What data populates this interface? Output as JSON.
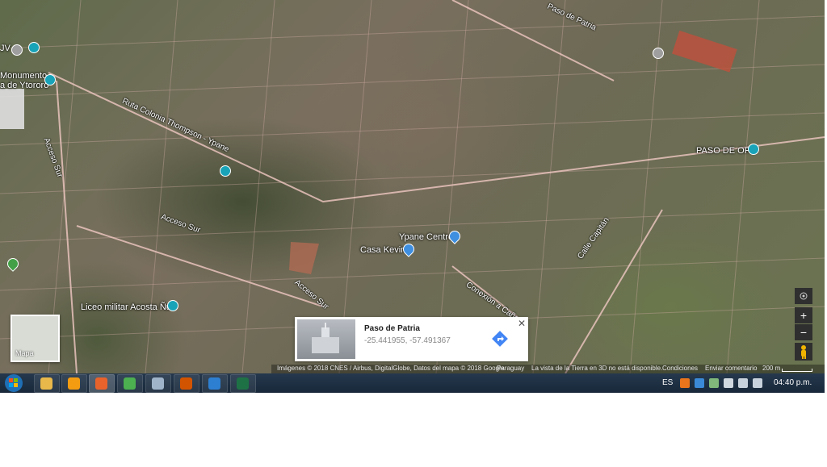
{
  "map": {
    "road_labels": {
      "paso_de_patria": "Paso de Patria",
      "ruta_colonia": "Ruta Colonia Thompson - Ypane",
      "acceso_sur_1": "Acceso Sur",
      "acceso_sur_2": "Acceso Sur",
      "acceso_sur_3": "Acceso Sur",
      "calle_capitan": "Calle Capitán",
      "conexion": "Conexión a Cañada"
    },
    "places": {
      "monumento": "Monumento",
      "ytororo": "a de Ytororo",
      "jv": "JV",
      "paso_de_oro": "PASO DE ORO",
      "ypane_centro": "Ypane Centro",
      "casa_kevin": "Casa Kevin",
      "liceo": "Liceo militar Acosta Ñu"
    },
    "thumbnail_label": "Mapa",
    "controls": {
      "zoom_in": "+",
      "zoom_out": "−"
    },
    "info_card": {
      "title": "Paso de Patria",
      "coords": "-25.441955, -57.491367"
    },
    "attribution": {
      "imagery": "Imágenes © 2018 CNES / Airbus, DigitalGlobe, Datos del mapa © 2018 Google",
      "country": "Paraguay",
      "earth_view": "La vista de la Tierra en 3D no está disponible.",
      "terms": "Condiciones",
      "feedback": "Enviar comentario",
      "scale": "200 m"
    }
  },
  "taskbar": {
    "language": "ES",
    "clock": "04:40 p.m.",
    "apps": [
      {
        "name": "explorer",
        "color": "#e8b84a"
      },
      {
        "name": "media-player",
        "color": "#f39c12"
      },
      {
        "name": "firefox",
        "color": "#e8632b"
      },
      {
        "name": "chrome",
        "color": "#4caf50"
      },
      {
        "name": "globe",
        "color": "#9fb4c8"
      },
      {
        "name": "paint",
        "color": "#d35400"
      },
      {
        "name": "network",
        "color": "#2d7fd1"
      },
      {
        "name": "excel",
        "color": "#1e7145"
      }
    ]
  }
}
